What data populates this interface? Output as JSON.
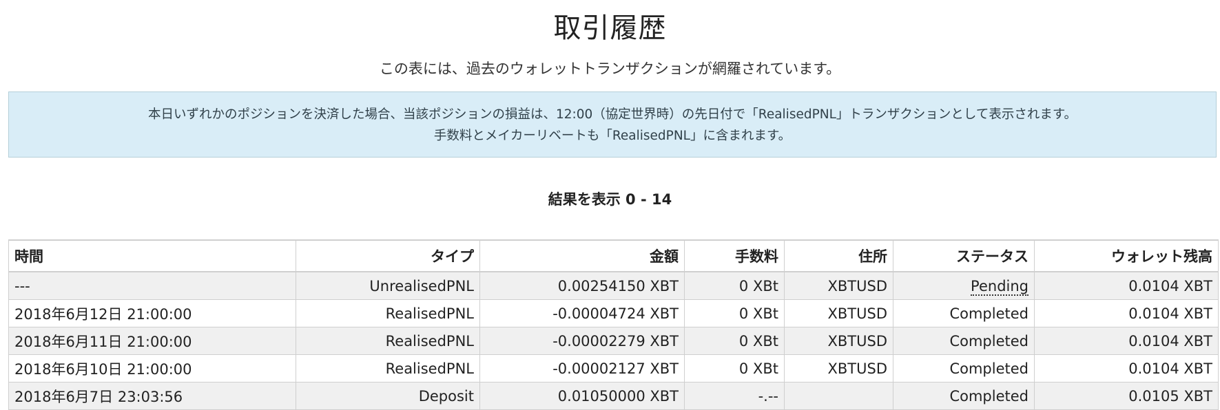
{
  "page": {
    "title": "取引履歴",
    "subtitle": "この表には、過去のウォレットトランザクションが網羅されています。"
  },
  "notice": {
    "line1": "本日いずれかのポジションを決済した場合、当該ポジションの損益は、12:00（協定世界時）の先日付で「RealisedPNL」トランザクションとして表示されます。",
    "line2": "手数料とメイカーリベートも「RealisedPNL」に含まれます。"
  },
  "results": {
    "label": "結果を表示 0 - 14"
  },
  "table": {
    "headers": [
      "時間",
      "タイプ",
      "金額",
      "手数料",
      "住所",
      "ステータス",
      "ウォレット残高"
    ],
    "rows": [
      [
        "---",
        "UnrealisedPNL",
        "0.00254150 XBT",
        "0 XBt",
        "XBTUSD",
        "Pending",
        "0.0104 XBT"
      ],
      [
        "2018年6月12日 21:00:00",
        "RealisedPNL",
        "-0.00004724 XBT",
        "0 XBt",
        "XBTUSD",
        "Completed",
        "0.0104 XBT"
      ],
      [
        "2018年6月11日 21:00:00",
        "RealisedPNL",
        "-0.00002279 XBT",
        "0 XBt",
        "XBTUSD",
        "Completed",
        "0.0104 XBT"
      ],
      [
        "2018年6月10日 21:00:00",
        "RealisedPNL",
        "-0.00002127 XBT",
        "0 XBt",
        "XBTUSD",
        "Completed",
        "0.0104 XBT"
      ],
      [
        "2018年6月7日 23:03:56",
        "Deposit",
        "0.01050000 XBT",
        "-.--",
        "",
        "Completed",
        "0.0105 XBT"
      ]
    ]
  }
}
